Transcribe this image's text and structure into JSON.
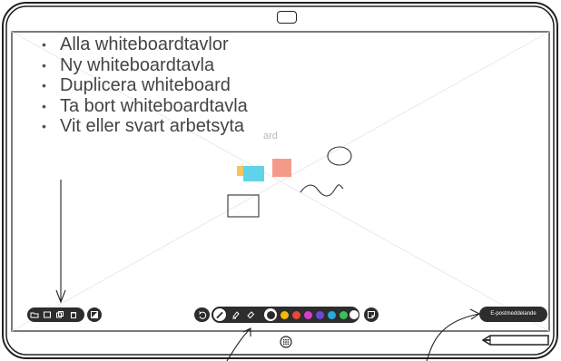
{
  "menu": {
    "items": [
      "Alla whiteboardtavlor",
      "Ny whiteboardtavla",
      "Duplicera whiteboard",
      "Ta bort whiteboardtavla",
      "Vit eller svart arbetsyta"
    ]
  },
  "canvas": {
    "ghost_text": "ard"
  },
  "toolbar": {
    "email_label": "E-postmeddelande",
    "colors": [
      "#2a2a2a",
      "#f5b70a",
      "#e8473b",
      "#d63dc8",
      "#6a49d8",
      "#2aa8e0",
      "#38c05a",
      "#ffffff"
    ],
    "sticky_colors": [
      "#f8c35a",
      "#5fd3e8",
      "#f49a8a"
    ]
  },
  "icons": {
    "left_group": [
      "folder-icon",
      "new-board-icon",
      "duplicate-icon",
      "trash-icon",
      "contrast-icon"
    ],
    "center_group": [
      "undo-icon",
      "pen-icon",
      "highlighter-icon",
      "eraser-icon",
      "sticky-note-icon"
    ],
    "home": "home-grid-icon",
    "camera": "camera-icon",
    "stylus": "stylus-icon"
  }
}
